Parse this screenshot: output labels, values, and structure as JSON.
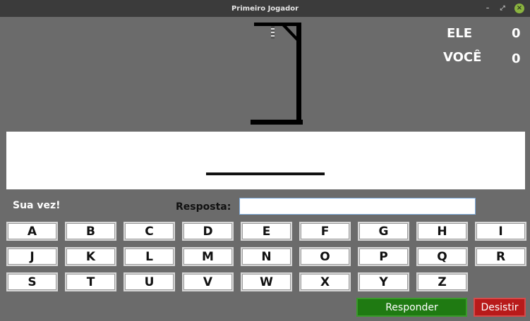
{
  "window": {
    "title": "Primeiro Jogador",
    "controls": [
      "minimize-icon",
      "maximize-icon",
      "close-icon"
    ]
  },
  "score": {
    "opponent_label": "ELE",
    "opponent_value": "0",
    "player_label": "VOCÊ",
    "player_value": "0"
  },
  "status": {
    "turn_text": "Sua vez!"
  },
  "answer": {
    "label": "Resposta:",
    "value": "",
    "placeholder": ""
  },
  "keyboard": {
    "row1": [
      "A",
      "B",
      "C",
      "D",
      "E",
      "F",
      "G",
      "H",
      "I"
    ],
    "row2": [
      "J",
      "K",
      "L",
      "M",
      "N",
      "O",
      "P",
      "Q",
      "R"
    ],
    "row3": [
      "S",
      "T",
      "U",
      "V",
      "W",
      "X",
      "Y",
      "Z"
    ]
  },
  "actions": {
    "answer_label": "Responder",
    "quit_label": "Desistir"
  },
  "colors": {
    "background": "#6b6b6b",
    "answer_button": "#1f7a12",
    "quit_button": "#b81a1a"
  }
}
